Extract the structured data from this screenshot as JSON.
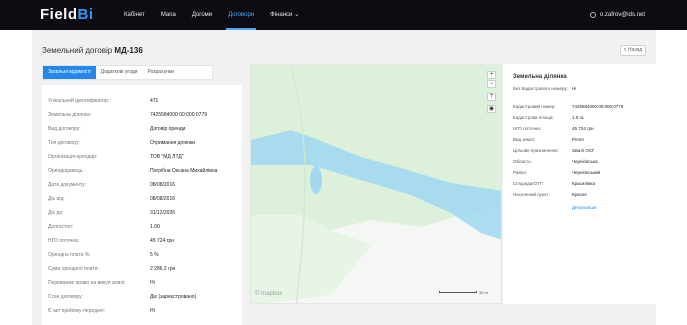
{
  "brand": {
    "name_main": "Field",
    "name_accent": "Bi"
  },
  "nav": [
    {
      "label": "Кабінет"
    },
    {
      "label": "Мапа"
    },
    {
      "label": "Догоми"
    },
    {
      "label": "Договори"
    },
    {
      "label": "Фінанси"
    }
  ],
  "user": {
    "email": "o.zafrov@ids.net"
  },
  "page": {
    "title_prefix": "Земельний договір",
    "title_number": "МД-136",
    "back_label": "< Назад"
  },
  "tabs": [
    {
      "label": "Загальні відомості"
    },
    {
      "label": "Додаткові угоди"
    },
    {
      "label": "Розрахунки"
    }
  ],
  "contract": [
    {
      "key": "Унікальний ідентифікатор:",
      "value": "471"
    },
    {
      "key": "Земельна ділянка:",
      "value": "7425584000:00:000:0779"
    },
    {
      "key": "Вид договору:",
      "value": "Договір оренди"
    },
    {
      "key": "Тип договору:",
      "value": "Отримання ділянки"
    },
    {
      "key": "Організація-орендар:",
      "value": "ТОВ \"МД ЛТД\""
    },
    {
      "key": "Орендодавець:",
      "value": "Погрібна Оксана Михайлівна"
    },
    {
      "key": "Дата документу:",
      "value": "08/08/2016"
    },
    {
      "key": "Діє від:",
      "value": "08/08/2016"
    },
    {
      "key": "Діє до:",
      "value": "31/12/2026"
    },
    {
      "key": "Долгостоп:",
      "value": "1.00"
    },
    {
      "key": "НГО поточна:",
      "value": "45 724 грн"
    },
    {
      "key": "Орендна плата %:",
      "value": "5 %"
    },
    {
      "key": "Сума орендної плати:",
      "value": "2 286.2 грн"
    },
    {
      "key": "Переважне право на викуп землі:",
      "value": "Ні"
    },
    {
      "key": "Стан договору:",
      "value": "Діє (зареєстровано)"
    },
    {
      "key": "Є акт прийому-передачі:",
      "value": "Ні"
    }
  ],
  "map": {
    "zoom_in": "+",
    "zoom_out": "−",
    "compass": "⇡",
    "layers": "◉",
    "attribution": "© mapbox",
    "scale_label": "30 m",
    "colors": {
      "land": "#ddf0dc",
      "parcel": "#a3d8ef",
      "road": "#f2f2f2"
    }
  },
  "parcel": {
    "title": "Земельна ділянка",
    "rows": [
      {
        "key": "Без Кадастрового номеру:",
        "value": "Ні"
      },
      {
        "key": "Кадастровий номер:",
        "value": "7425584000:00:000:0779"
      },
      {
        "key": "Кадастрова площа:",
        "value": "1.0 га"
      },
      {
        "key": "НГО поточна:",
        "value": "45 724 грн"
      },
      {
        "key": "Вид землі:",
        "value": "Рілля"
      },
      {
        "key": "Цільове призначення:",
        "value": "Землі ОСГ"
      },
      {
        "key": "Область:",
        "value": "Чернігівська"
      },
      {
        "key": "Район:",
        "value": "Чернігівський"
      },
      {
        "key": "Сільрада/ОТГ:",
        "value": "Красилівка"
      },
      {
        "key": "Населений пункт:",
        "value": "Красне"
      }
    ],
    "details_link": "Детальніше"
  }
}
